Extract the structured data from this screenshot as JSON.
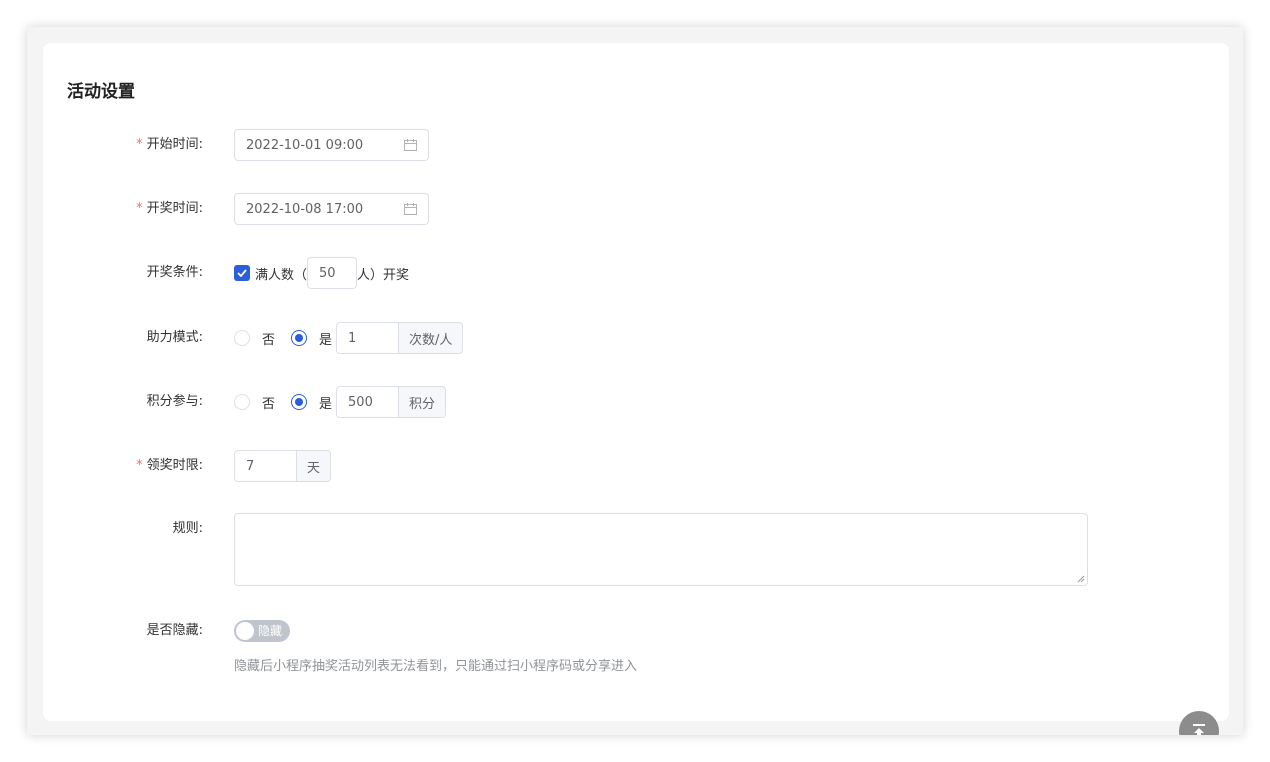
{
  "card": {
    "title": "活动设置"
  },
  "form": {
    "start_time": {
      "label": "开始时间:",
      "value": "2022-10-01 09:00",
      "required": true
    },
    "draw_time": {
      "label": "开奖时间:",
      "value": "2022-10-08 17:00",
      "required": true
    },
    "draw_condition": {
      "label": "开奖条件:",
      "checkbox_checked": true,
      "text_before": "满人数（",
      "value": "50",
      "text_after": "人）开奖"
    },
    "assist_mode": {
      "label": "助力模式:",
      "option_no": "否",
      "option_yes": "是",
      "selected": "是",
      "value": "1",
      "unit": "次数/人"
    },
    "points_participation": {
      "label": "积分参与:",
      "option_no": "否",
      "option_yes": "是",
      "selected": "是",
      "value": "500",
      "unit": "积分"
    },
    "claim_limit": {
      "label": "领奖时限:",
      "value": "7",
      "unit": "天",
      "required": true
    },
    "rules": {
      "label": "规则:",
      "value": ""
    },
    "hidden": {
      "label": "是否隐藏:",
      "switch_text": "隐藏",
      "switch_on": false,
      "tip": "隐藏后小程序抽奖活动列表无法看到，只能通过扫小程序码或分享进入"
    }
  },
  "required_mark": "*",
  "colors": {
    "primary": "#2b5fd9",
    "required": "#f56c6c",
    "switch_off": "#c0c4cc"
  },
  "icons": {
    "date": "calendar-icon",
    "back_to_top": "back-to-top-icon",
    "check": "check-icon"
  }
}
